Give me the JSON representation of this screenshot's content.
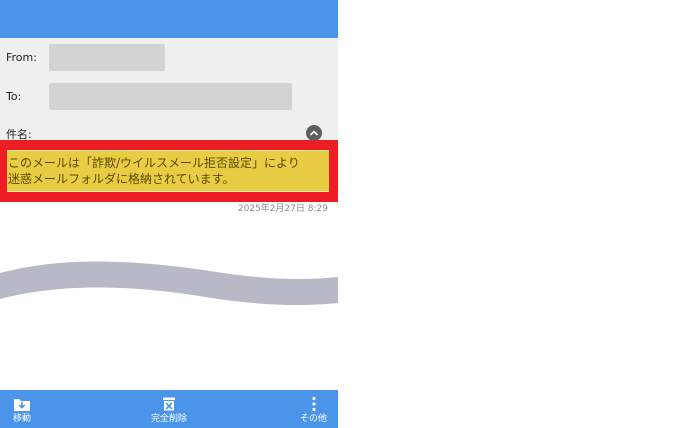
{
  "header": {
    "from_label": "From:",
    "to_label": "To:",
    "subject_label": "件名:",
    "collapse_icon": "chevron-up-icon"
  },
  "notice": {
    "text": "このメールは「詐欺/ウイルスメール拒否設定」により\n迷惑メールフォルダに格納されています。"
  },
  "timestamp": "2025年2月27日 8:29",
  "toolbar": {
    "move_label": "移動",
    "move_icon": "move-folder-icon",
    "delete_label": "完全削除",
    "delete_icon": "delete-icon",
    "more_label": "その他",
    "more_icon": "more-vertical-icon"
  },
  "colors": {
    "accent": "#4a95ea",
    "highlight_border": "#ee1c25",
    "notice_bg": "#e8cc44",
    "wave": "#b8b9c7"
  }
}
